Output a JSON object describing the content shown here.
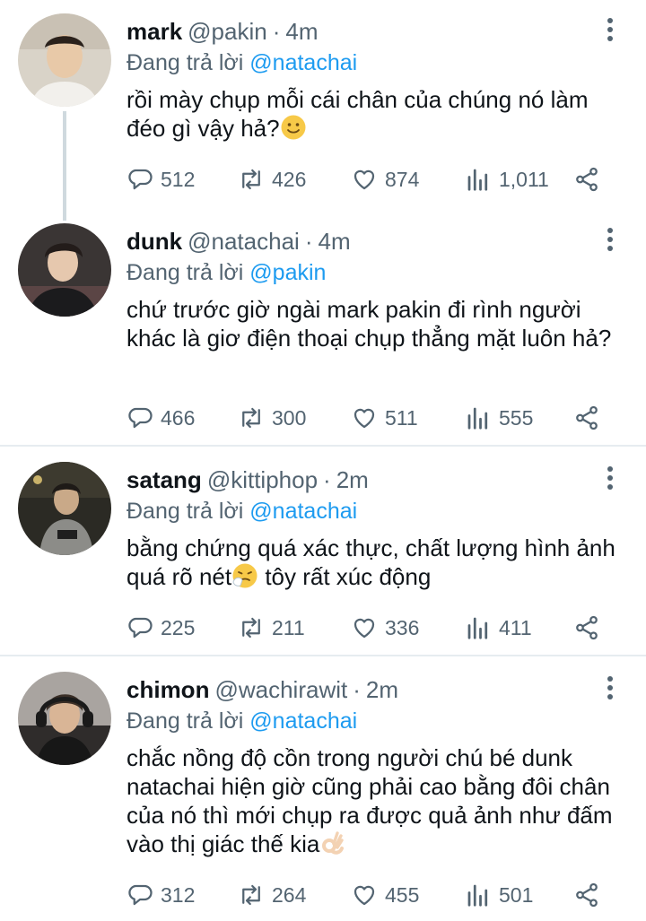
{
  "tweets": [
    {
      "name": "mark",
      "handle": "@pakin",
      "sep": "·",
      "time": "4m",
      "replying_prefix": "Đang trả lời",
      "replying_to": "@natachai",
      "text": "rồi mày chụp mỗi cái chân của chúng nó làm đéo gì vậy hả?",
      "emoji": "slightly-smiling-face",
      "replies": "512",
      "retweets": "426",
      "likes": "874",
      "views": "1,011"
    },
    {
      "name": "dunk",
      "handle": "@natachai",
      "sep": "·",
      "time": "4m",
      "replying_prefix": "Đang trả lời",
      "replying_to": "@pakin",
      "text": "chứ trước giờ ngài mark pakin đi rình người khác là giơ điện thoại chụp thẳng mặt luôn hả?",
      "replies": "466",
      "retweets": "300",
      "likes": "511",
      "views": "555"
    },
    {
      "name": "satang",
      "handle": "@kittiphop",
      "sep": "·",
      "time": "2m",
      "replying_prefix": "Đang trả lời",
      "replying_to": "@natachai",
      "text_before": "bằng chứng quá xác thực, chất lượng hình ảnh quá rõ nét",
      "emoji": "sneezing-face",
      "text_after": " tôy rất xúc động",
      "replies": "225",
      "retweets": "211",
      "likes": "336",
      "views": "411"
    },
    {
      "name": "chimon",
      "handle": "@wachirawit",
      "sep": "·",
      "time": "2m",
      "replying_prefix": "Đang trả lời",
      "replying_to": "@natachai",
      "text": "chắc nồng độ cồn trong người chú bé dunk natachai hiện giờ cũng phải cao bằng đôi chân của nó thì mới chụp ra được quả ảnh như đấm vào thị giác thế kia",
      "emoji": "ok-hand",
      "replies": "312",
      "retweets": "264",
      "likes": "455",
      "views": "501"
    }
  ],
  "colors": {
    "accent": "#1d9bf0",
    "muted": "#536471",
    "text": "#0f1419",
    "divider": "#e6ecf0",
    "thread_line": "#cfd9de"
  },
  "icons": [
    "reply-icon",
    "retweet-icon",
    "like-icon",
    "views-icon",
    "share-icon",
    "more-icon"
  ]
}
